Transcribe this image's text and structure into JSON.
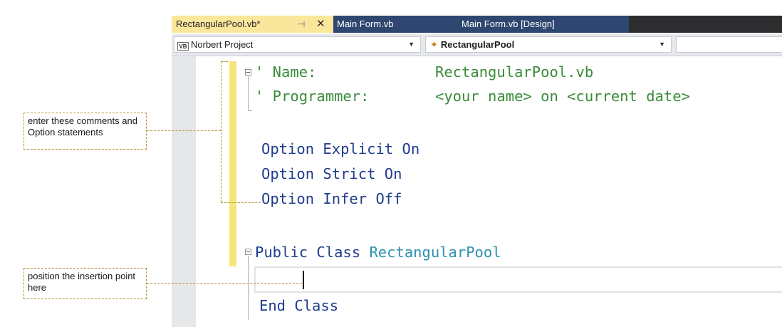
{
  "tabs": [
    {
      "label": "RectangularPool.vb*",
      "active": true
    },
    {
      "label": "Main Form.vb",
      "active": false
    },
    {
      "label": "Main Form.vb [Design]",
      "active": false
    }
  ],
  "navbar": {
    "project_icon": "VB",
    "project_label": "Norbert Project",
    "class_label": "RectangularPool",
    "member_label": ""
  },
  "code": {
    "comment_name_key": "' Name:",
    "comment_name_value": "RectangularPool.vb",
    "comment_programmer_key": "' Programmer:",
    "comment_programmer_value": "<your name> on <current date>",
    "option_explicit": "Option Explicit On",
    "option_strict": "Option Strict On",
    "option_infer": "Option Infer Off",
    "public_class_kw": "Public Class ",
    "class_name": "RectangularPool",
    "end_class": "End Class"
  },
  "callouts": {
    "comments_text": "enter these comments and Option statements",
    "insertion_text": "position the insertion point here"
  },
  "colors": {
    "comment": "#3a8c3a",
    "keyword": "#1f3d8e",
    "type": "#2b91af",
    "active_tab": "#fbe79c",
    "inactive_tab": "#2e4770",
    "change_bar": "#f6e67a",
    "callout_border": "#b79234"
  },
  "icons": {
    "pin": "pin-icon",
    "close": "close-icon",
    "project": "vb-project-icon",
    "class": "class-icon",
    "dropdown": "chevron-down-icon"
  }
}
